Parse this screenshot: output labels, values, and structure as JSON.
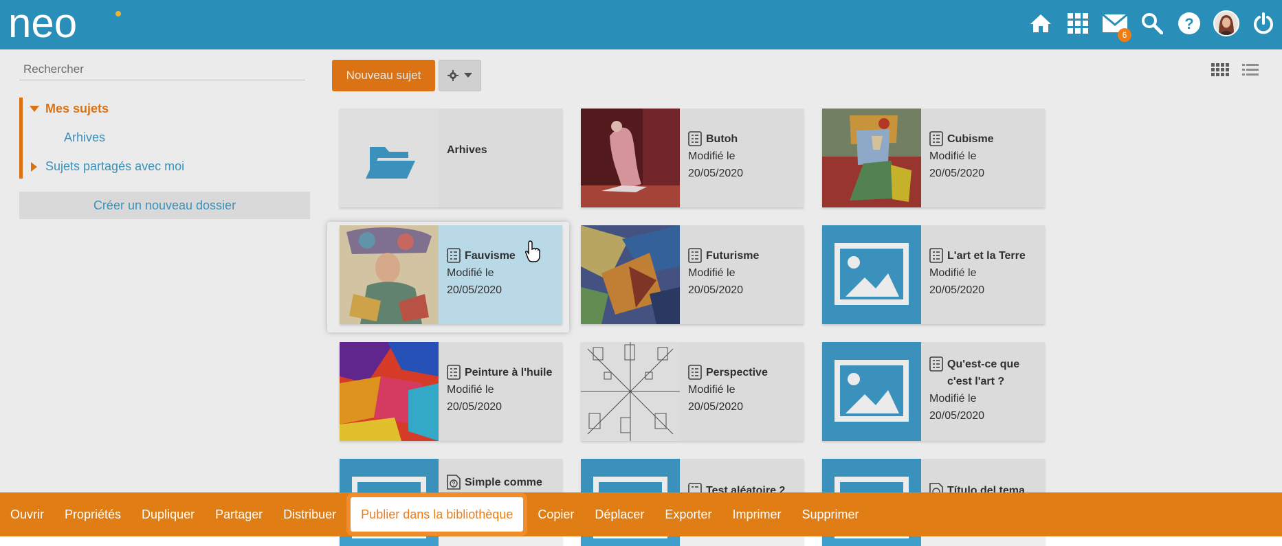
{
  "app": {
    "logo_text": "neo",
    "colors": {
      "topbar": "#2a8fb8",
      "accent": "#ee7d16",
      "actionbar": "#e07d14",
      "selected_card": "#c9ecfb",
      "link": "#3f9fcc"
    }
  },
  "topbar": {
    "icons": [
      "home-icon",
      "apps-grid-icon",
      "mail-icon",
      "search-icon",
      "help-icon",
      "avatar",
      "power-icon"
    ],
    "mail_badge": "6"
  },
  "sidebar": {
    "search_placeholder": "Rechercher",
    "tree": {
      "mes_sujets": "Mes sujets",
      "arhives": "Arhives",
      "partages": "Sujets partagés avec moi"
    },
    "new_folder_label": "Créer un nouveau dossier"
  },
  "toolbar": {
    "new_subject_label": "Nouveau sujet",
    "settings_icon": "gear-icon",
    "views": [
      "grid-view-icon",
      "list-view-icon"
    ]
  },
  "cards": [
    {
      "title": "Arhives",
      "type": "folder"
    },
    {
      "title": "Butoh",
      "modified_label": "Modifié le",
      "date": "20/05/2020",
      "type": "subject"
    },
    {
      "title": "Cubisme",
      "modified_label": "Modifié le",
      "date": "20/05/2020",
      "type": "subject"
    },
    {
      "title": "Fauvisme",
      "modified_label": "Modifié le",
      "date": "20/05/2020",
      "type": "subject",
      "selected": true
    },
    {
      "title": "Futurisme",
      "modified_label": "Modifié le",
      "date": "20/05/2020",
      "type": "subject"
    },
    {
      "title": "L'art et la Terre",
      "modified_label": "Modifié le",
      "date": "20/05/2020",
      "type": "subject"
    },
    {
      "title": "Peinture à l'huile",
      "modified_label": "Modifié le",
      "date": "20/05/2020",
      "type": "subject"
    },
    {
      "title": "Perspective",
      "modified_label": "Modifié le",
      "date": "20/05/2020",
      "type": "subject"
    },
    {
      "title": "Qu'est-ce que c'est l'art ?",
      "modified_label": "Modifié le",
      "date": "20/05/2020",
      "type": "subject"
    },
    {
      "title": "Simple comme",
      "type": "subject"
    },
    {
      "title": "Test aléatoire 2",
      "type": "subject"
    },
    {
      "title": "Título del tema",
      "type": "subject"
    }
  ],
  "actions": [
    "Ouvrir",
    "Propriétés",
    "Dupliquer",
    "Partager",
    "Distribuer",
    "Publier dans la bibliothèque",
    "Copier",
    "Déplacer",
    "Exporter",
    "Imprimer",
    "Supprimer"
  ],
  "active_action": "Publier dans la bibliothèque"
}
